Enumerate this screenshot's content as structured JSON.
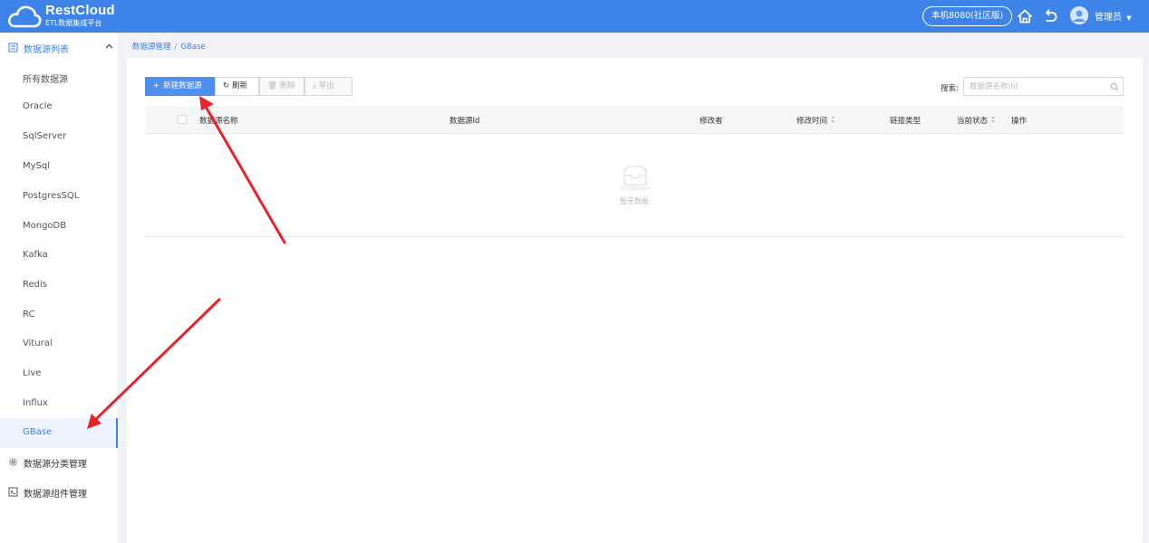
{
  "header": {
    "logo_title": "RestCloud",
    "logo_subtitle": "ETL数据集成平台",
    "server_badge": "本机8080(社区版)",
    "user_name": "管理员"
  },
  "sidebar": {
    "group_datasource_list": "数据源列表",
    "items": [
      {
        "label": "所有数据源"
      },
      {
        "label": "Oracle"
      },
      {
        "label": "SqlServer"
      },
      {
        "label": "MySql"
      },
      {
        "label": "PostgresSQL"
      },
      {
        "label": "MongoDB"
      },
      {
        "label": "Kafka"
      },
      {
        "label": "Redis"
      },
      {
        "label": "RC"
      },
      {
        "label": "Vitural"
      },
      {
        "label": "Live"
      },
      {
        "label": "Influx"
      },
      {
        "label": "GBase"
      }
    ],
    "group_category": "数据源分类管理",
    "group_component": "数据源组件管理"
  },
  "breadcrumb": {
    "root": "数据源管理",
    "separator": "/",
    "current": "GBase"
  },
  "toolbar": {
    "new_label": "新建数据源",
    "refresh_label": "刷新",
    "delete_label": "删除",
    "export_label": "导出",
    "search_label": "搜索:",
    "search_placeholder": "数据源名称|Id"
  },
  "table": {
    "columns": [
      "数据源名称",
      "数据源Id",
      "修改者",
      "修改时间",
      "链接类型",
      "当前状态",
      "操作"
    ],
    "empty_text": "暂无数据"
  },
  "colors": {
    "header_bg": "#3d83e8",
    "primary": "#4f8ff0",
    "annotation_arrow": "#e8232a"
  }
}
